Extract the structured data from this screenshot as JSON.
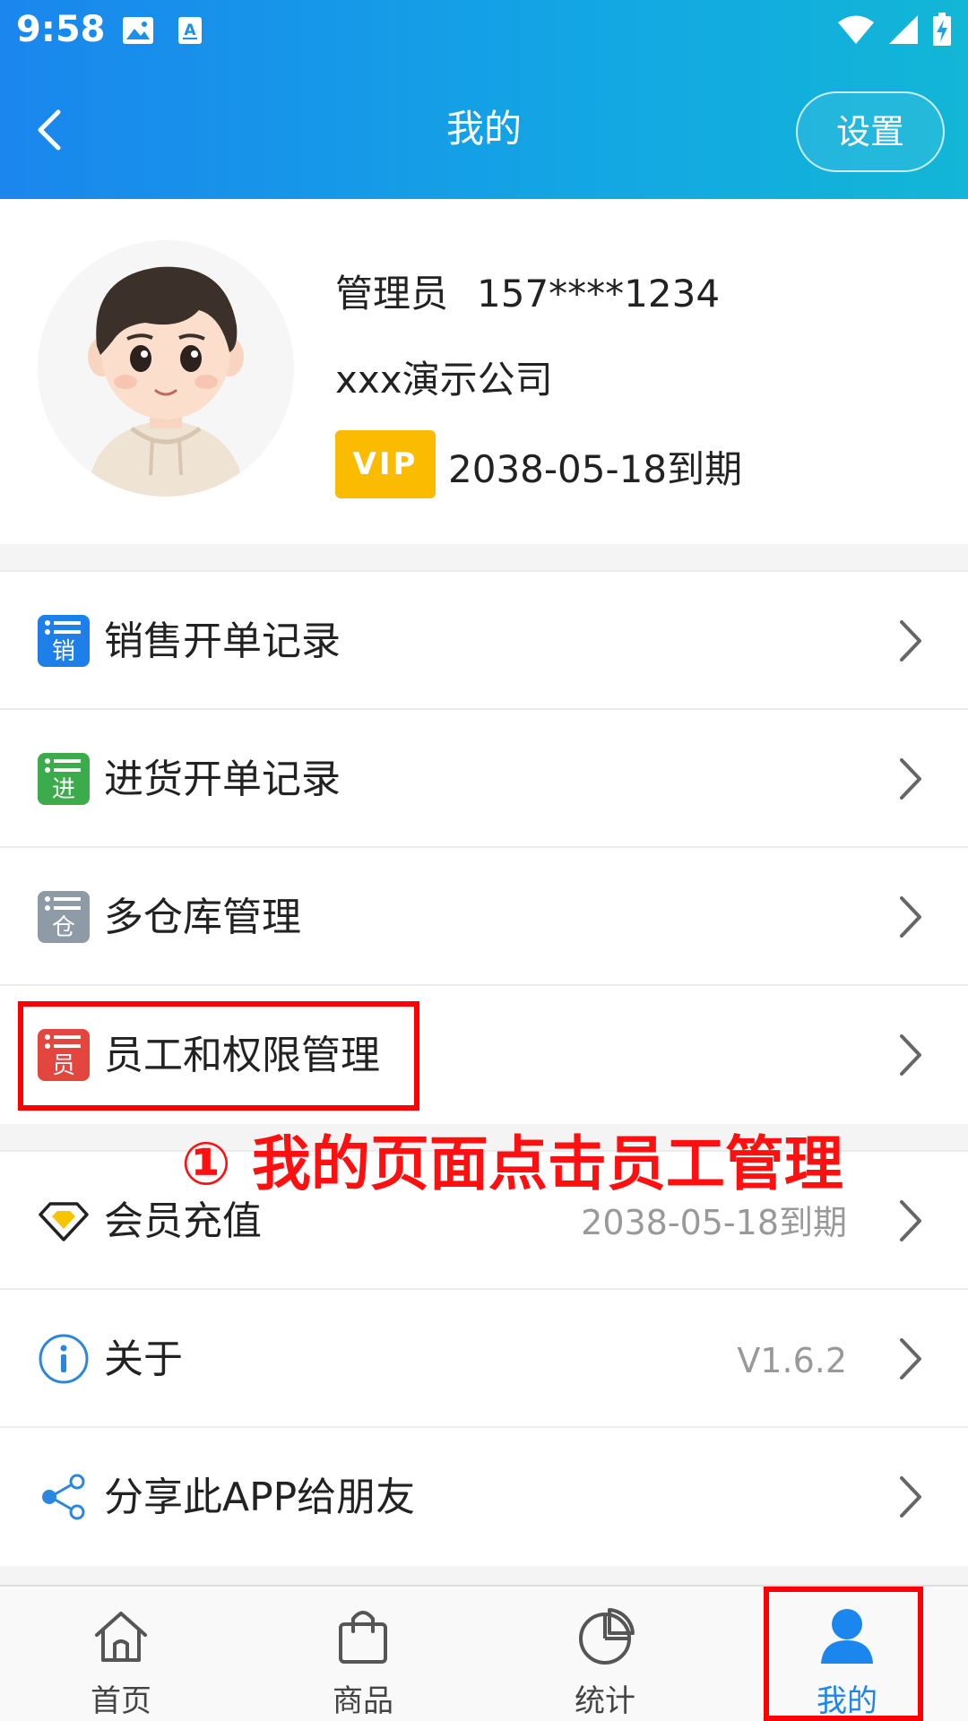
{
  "status_bar": {
    "time": "9:58"
  },
  "header": {
    "title": "我的",
    "settings_label": "设置"
  },
  "profile": {
    "role": "管理员",
    "phone": "157****1234",
    "company": "xxx演示公司",
    "vip_label": "VIP",
    "vip_expire": "2038-05-18到期"
  },
  "menu": {
    "group1": [
      {
        "label": "销售开单记录",
        "icon_char": "销",
        "color": "#1f7fe8"
      },
      {
        "label": "进货开单记录",
        "icon_char": "进",
        "color": "#3bab4b"
      },
      {
        "label": "多仓库管理",
        "icon_char": "仓",
        "color": "#8e9aa6"
      },
      {
        "label": "员工和权限管理",
        "icon_char": "员",
        "color": "#e3463f"
      }
    ],
    "group2": [
      {
        "label": "会员充值",
        "value": "2038-05-18到期",
        "icon": "diamond-icon"
      },
      {
        "label": "关于",
        "value": "V1.6.2",
        "icon": "info-icon"
      },
      {
        "label": "分享此APP给朋友",
        "icon": "share-icon"
      }
    ]
  },
  "annotation": {
    "text": "① 我的页面点击员工管理"
  },
  "tabbar": [
    {
      "label": "首页",
      "icon": "home-icon"
    },
    {
      "label": "商品",
      "icon": "shopping-bag-icon"
    },
    {
      "label": "统计",
      "icon": "pie-chart-icon"
    },
    {
      "label": "我的",
      "icon": "user-icon",
      "active": true
    }
  ],
  "colors": {
    "accent": "#1a86ee",
    "vip": "#fbbb00",
    "annotation": "#ff0000"
  }
}
